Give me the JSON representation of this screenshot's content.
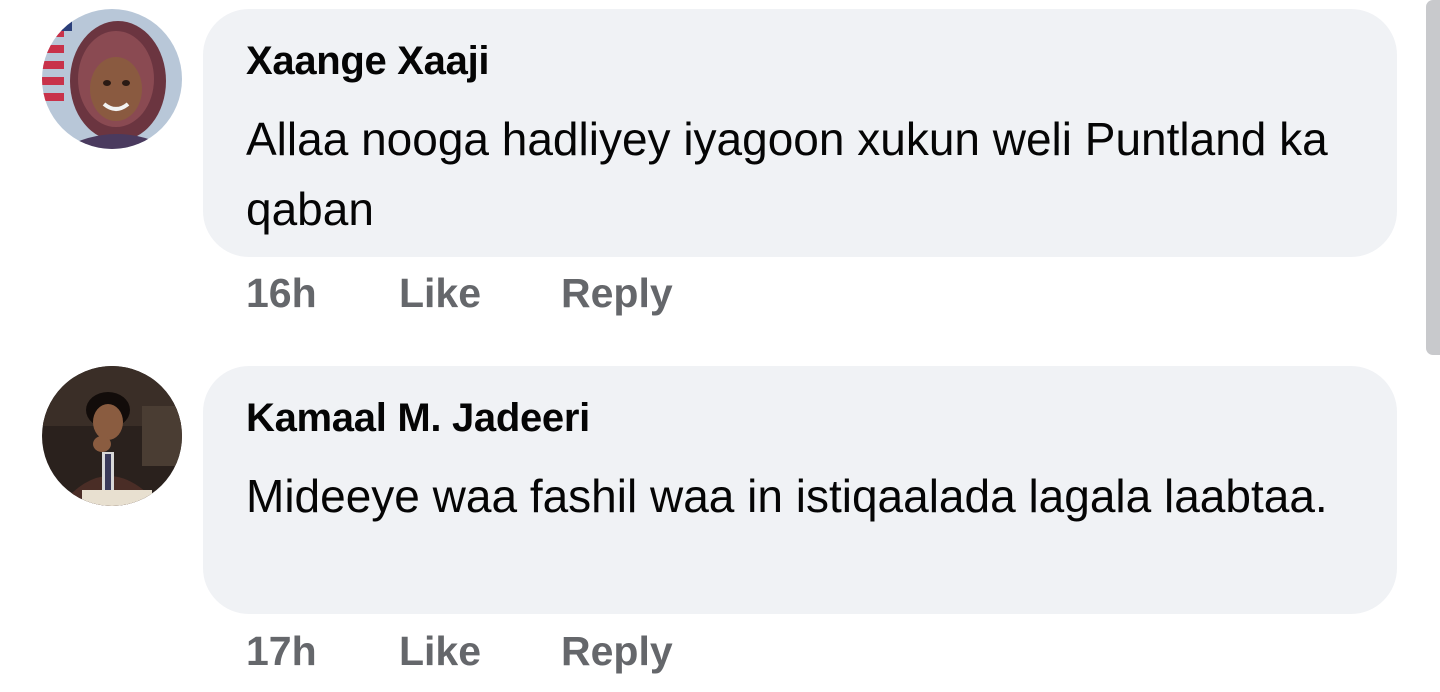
{
  "comments": [
    {
      "author": "Xaange Xaaji",
      "text": "Allaa nooga hadliyey iyagoon xukun weli Puntland ka qaban",
      "time": "16h",
      "like_label": "Like",
      "reply_label": "Reply"
    },
    {
      "author": "Kamaal M. Jadeeri",
      "text": "Mideeye waa fashil waa in istiqaalada lagala laabtaa.",
      "time": "17h",
      "like_label": "Like",
      "reply_label": "Reply"
    }
  ],
  "icons": {
    "avatar1": "profile-photo-avatar",
    "avatar2": "profile-photo-avatar"
  },
  "colors": {
    "bubble": "#f0f2f5",
    "text": "#050505",
    "secondary": "#65676b"
  }
}
